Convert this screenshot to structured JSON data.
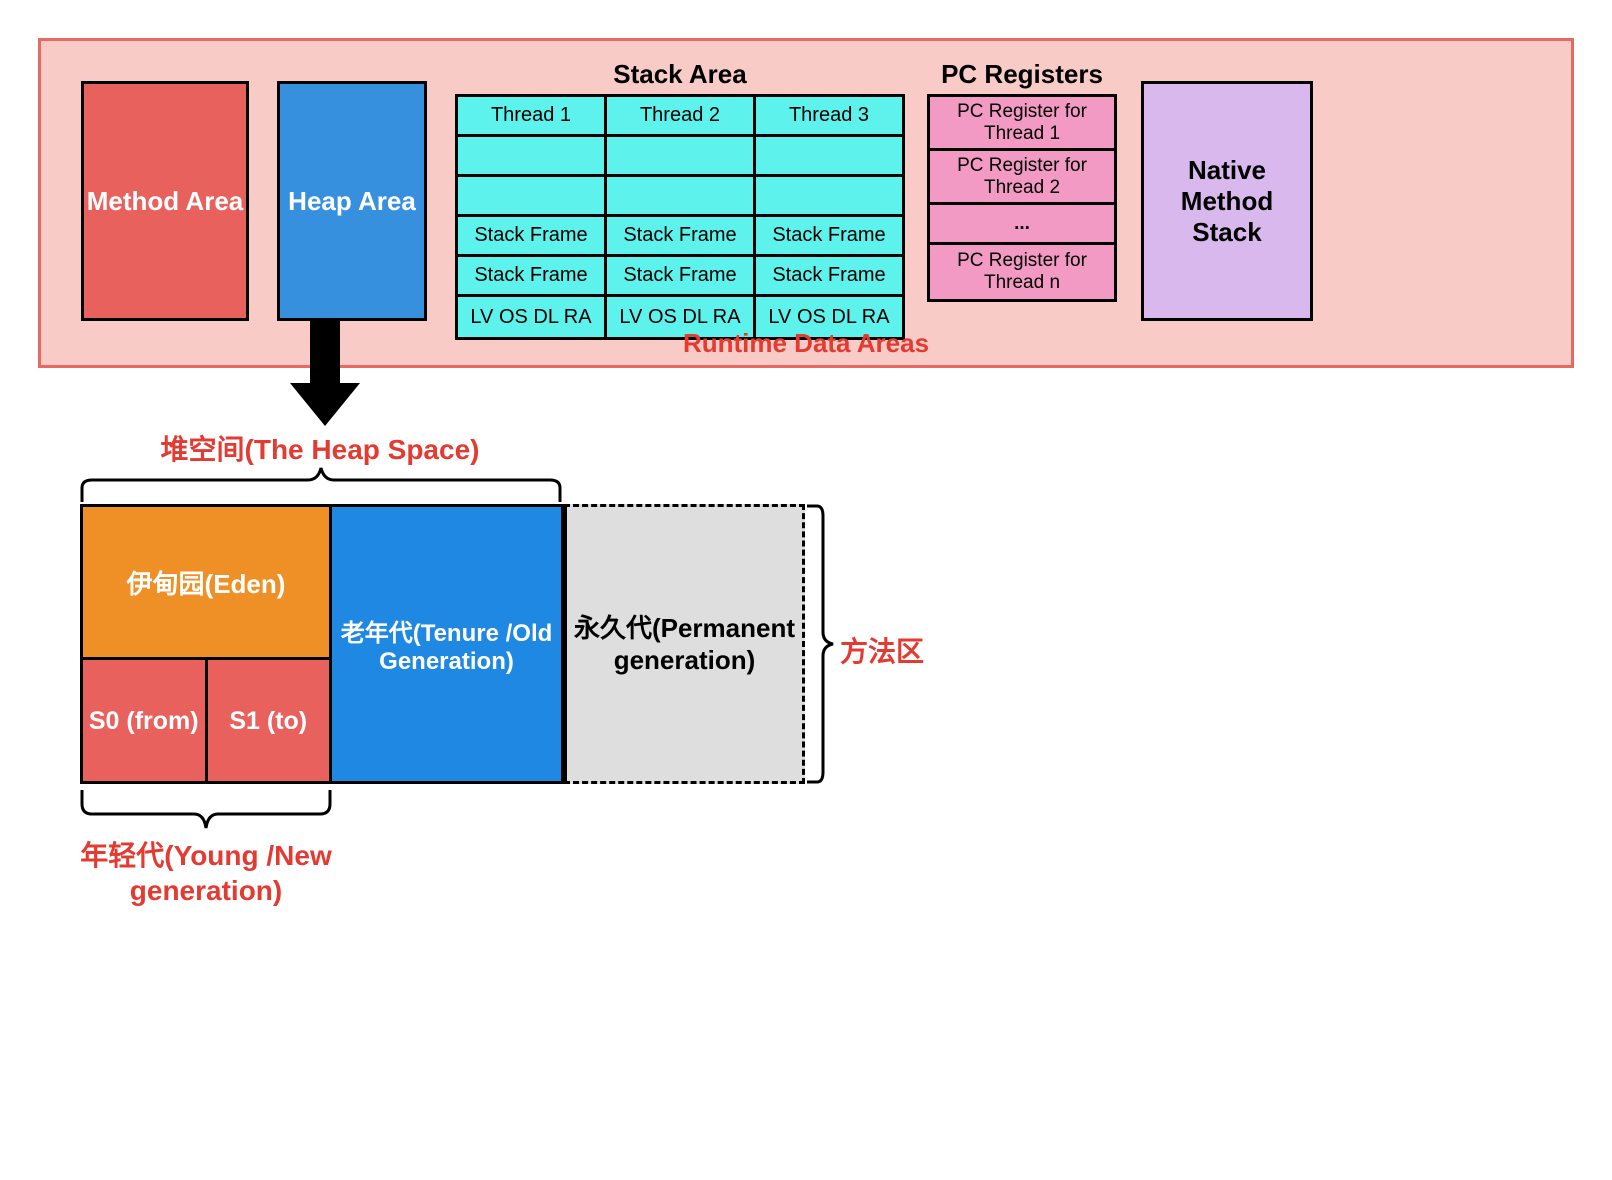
{
  "runtime": {
    "title": "Runtime Data Areas",
    "method_area": "Method Area",
    "heap_area": "Heap Area",
    "stack_title": "Stack Area",
    "threads": {
      "t1": "Thread 1",
      "t2": "Thread 2",
      "t3": "Thread 3",
      "sf": "Stack Frame",
      "lv": "LV OS DL RA"
    },
    "pc_title": "PC Registers",
    "pc": {
      "p1": "PC Register for Thread 1",
      "p2": "PC Register for Thread 2",
      "dots": "...",
      "pn": "PC Register for Thread n"
    },
    "native": "Native Method Stack"
  },
  "heap": {
    "space_label": "堆空间(The Heap Space)",
    "eden": "伊甸园(Eden)",
    "s0": "S0 (from)",
    "s1": "S1 (to)",
    "old": "老年代(Tenure /Old Generation)",
    "perm": "永久代(Permanent generation)",
    "method_area_label": "方法区",
    "young_label": "年轻代(Young /New generation)"
  }
}
